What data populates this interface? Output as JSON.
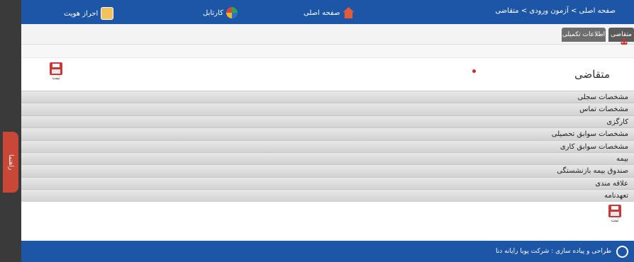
{
  "topbar": {
    "breadcrumb": "صفحه اصلی > آزمون ورودی > متقاضی",
    "home_label": "صفحه اصلی",
    "portal_label": "کارتابل",
    "identity_label": "احراز هویت"
  },
  "tabs": [
    {
      "label": "متقاضی"
    },
    {
      "label": "اطلاعات تکمیلی"
    }
  ],
  "side_tab": {
    "label": "راهنما"
  },
  "form": {
    "title": "متقاضی",
    "save_label": "ثبت"
  },
  "sections": [
    {
      "label": "مشخصات سجلی"
    },
    {
      "label": "مشخصات تماس"
    },
    {
      "label": "کارگزی"
    },
    {
      "label": "مشخصات سوابق تحصیلی"
    },
    {
      "label": "مشخصات سوابق کاری"
    },
    {
      "label": "بیمه"
    },
    {
      "label": "صندوق بیمه بازنشستگی"
    },
    {
      "label": "علاقه مندی"
    },
    {
      "label": "تعهدنامه"
    }
  ],
  "footer": {
    "text": "طراحی و پیاده سازی : شرکت پویا رایانه دنا"
  },
  "colors": {
    "topbar": "#1d56a6",
    "tab": "#6e6e6e",
    "save_icon": "#c83a3a"
  }
}
